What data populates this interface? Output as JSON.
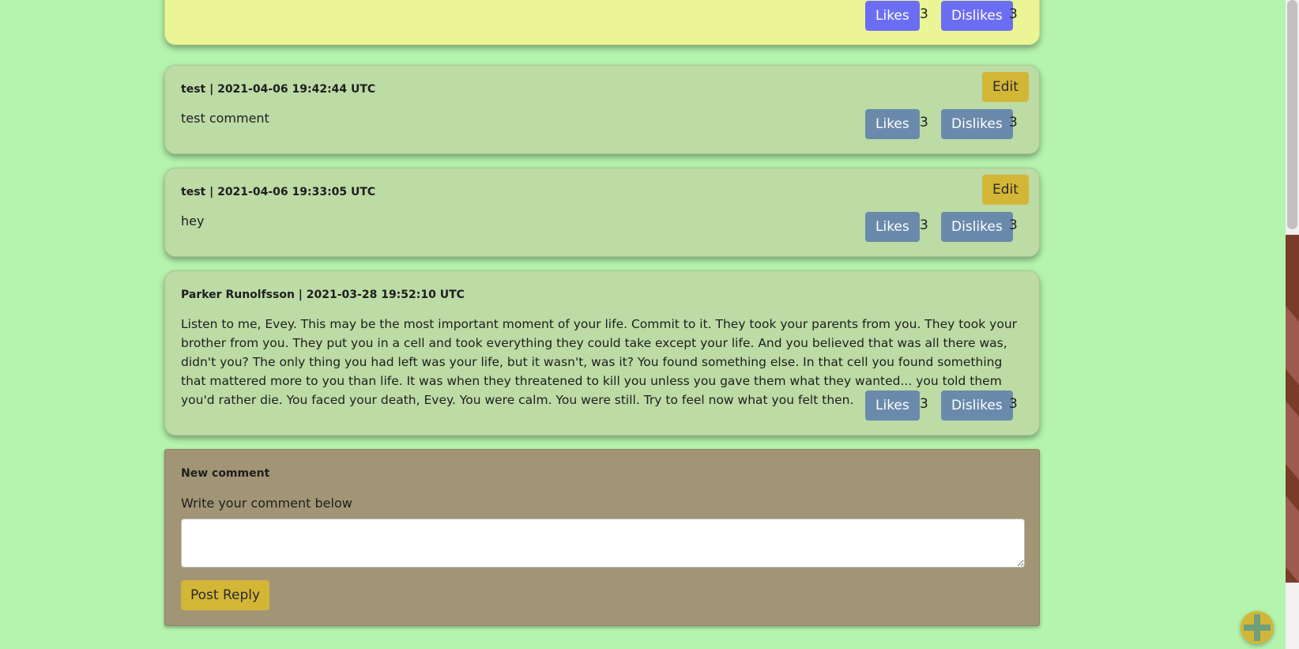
{
  "top_comment": {
    "likes_label": "Likes",
    "likes_count": "3",
    "dislikes_label": "Dislikes",
    "dislikes_count": "3"
  },
  "comments": [
    {
      "meta": "test | 2021-04-06 19:42:44 UTC",
      "text": "test comment",
      "edit_label": "Edit",
      "likes_label": "Likes",
      "likes_count": "3",
      "dislikes_label": "Dislikes",
      "dislikes_count": "3"
    },
    {
      "meta": "test | 2021-04-06 19:33:05 UTC",
      "text": "hey",
      "edit_label": "Edit",
      "likes_label": "Likes",
      "likes_count": "3",
      "dislikes_label": "Dislikes",
      "dislikes_count": "3"
    },
    {
      "meta": "Parker Runolfsson | 2021-03-28 19:52:10 UTC",
      "text": "Listen to me, Evey. This may be the most important moment of your life. Commit to it. They took your parents from you. They took your brother from you. They put you in a cell and took everything they could take except your life. And you believed that was all there was, didn't you? The only thing you had left was your life, but it wasn't, was it? You found something else. In that cell you found something that mattered more to you than life. It was when they threatened to kill you unless you gave them what they wanted... you told them you'd rather die. You faced your death, Evey. You were calm. You were still. Try to feel now what you felt then.",
      "likes_label": "Likes",
      "likes_count": "3",
      "dislikes_label": "Dislikes",
      "dislikes_count": "3"
    }
  ],
  "new_comment": {
    "title": "New comment",
    "label": "Write your comment below",
    "textarea_value": "",
    "post_label": "Post Reply"
  },
  "fab_icon": "plus-icon"
}
